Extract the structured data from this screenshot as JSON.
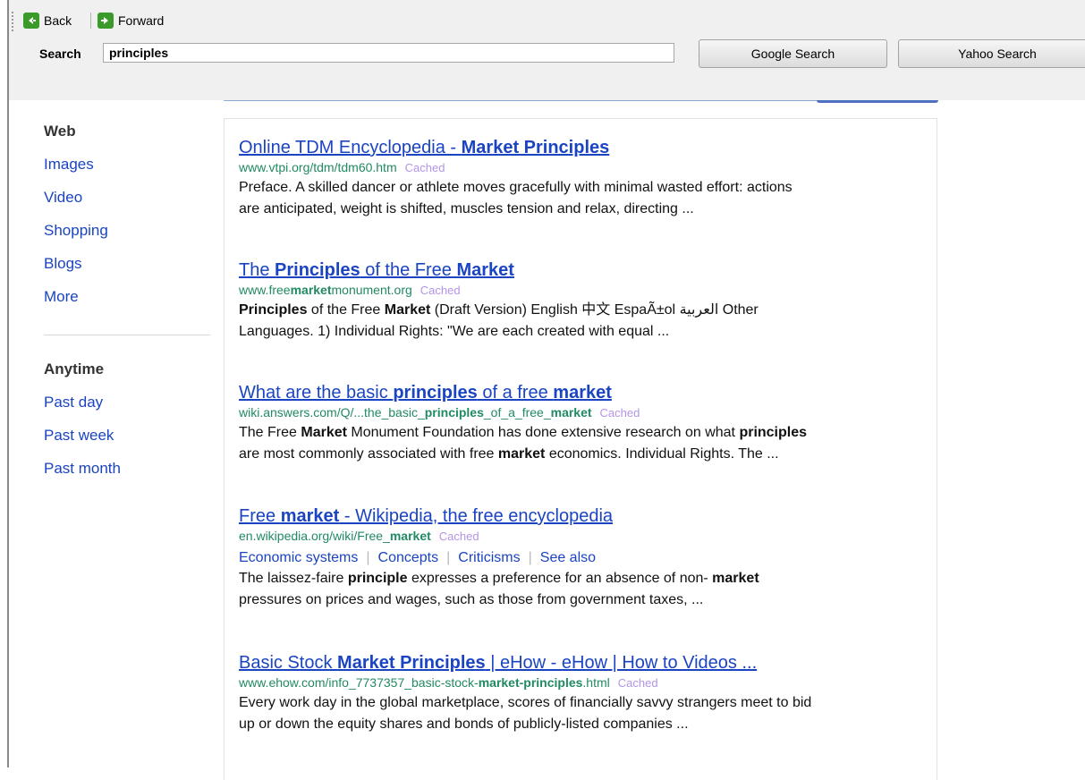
{
  "toolbar": {
    "back_label": "Back",
    "forward_label": "Forward",
    "search_label": "Search",
    "search_value": "principles",
    "google_button": "Google Search",
    "yahoo_button": "Yahoo Search"
  },
  "sidebar": {
    "types": [
      {
        "label": "Web",
        "active": true
      },
      {
        "label": "Images",
        "active": false
      },
      {
        "label": "Video",
        "active": false
      },
      {
        "label": "Shopping",
        "active": false
      },
      {
        "label": "Blogs",
        "active": false
      },
      {
        "label": "More",
        "active": false
      }
    ],
    "times": [
      {
        "label": "Anytime",
        "active": true
      },
      {
        "label": "Past day",
        "active": false
      },
      {
        "label": "Past week",
        "active": false
      },
      {
        "label": "Past month",
        "active": false
      }
    ]
  },
  "cached_label": "Cached",
  "results": [
    {
      "title": [
        [
          "Online TDM Encyclopedia - ",
          false
        ],
        [
          "Market Principles",
          true
        ]
      ],
      "url": [
        [
          "www.vtpi.org/tdm/tdm60.htm",
          false
        ]
      ],
      "links": [],
      "snippet": [
        [
          [
            "Preface. A skilled dancer or athlete moves gracefully with minimal wasted effort: actions",
            false
          ]
        ],
        [
          [
            "are anticipated, weight is shifted, muscles tension and relax, directing ...",
            false
          ]
        ]
      ]
    },
    {
      "title": [
        [
          "The ",
          false
        ],
        [
          "Principles",
          true
        ],
        [
          " of the Free ",
          false
        ],
        [
          "Market",
          true
        ]
      ],
      "url": [
        [
          "www.free",
          false
        ],
        [
          "market",
          true
        ],
        [
          "monument.org",
          false
        ]
      ],
      "links": [],
      "snippet": [
        [
          [
            "Principles",
            true
          ],
          [
            " of the Free ",
            false
          ],
          [
            "Market",
            true
          ],
          [
            " (Draft Version) English 中文 EspaÃ±ol العربية Other",
            false
          ]
        ],
        [
          [
            "Languages. 1) Individual Rights: \"We are each created with equal ...",
            false
          ]
        ]
      ]
    },
    {
      "title": [
        [
          "What are the basic ",
          false
        ],
        [
          "principles",
          true
        ],
        [
          " of a free ",
          false
        ],
        [
          "market",
          true
        ]
      ],
      "url": [
        [
          "wiki.answers.com/Q/...the_basic_",
          false
        ],
        [
          "principles",
          true
        ],
        [
          "_of_a_free_",
          false
        ],
        [
          "market",
          true
        ]
      ],
      "links": [],
      "snippet": [
        [
          [
            "The Free ",
            false
          ],
          [
            "Market",
            true
          ],
          [
            " Monument Foundation has done extensive research on what ",
            false
          ],
          [
            "principles",
            true
          ]
        ],
        [
          [
            "are most commonly associated with free ",
            false
          ],
          [
            "market",
            true
          ],
          [
            " economics. Individual Rights. The ...",
            false
          ]
        ]
      ]
    },
    {
      "title": [
        [
          "Free ",
          false
        ],
        [
          "market",
          true
        ],
        [
          " - Wikipedia, the free encyclopedia",
          false
        ]
      ],
      "url": [
        [
          "en.wikipedia.org/wiki/Free_",
          false
        ],
        [
          "market",
          true
        ]
      ],
      "links": [
        "Economic systems",
        "Concepts",
        "Criticisms",
        "See also"
      ],
      "snippet": [
        [
          [
            "The laissez-faire ",
            false
          ],
          [
            "principle",
            true
          ],
          [
            " expresses a preference for an absence of non- ",
            false
          ],
          [
            "market",
            true
          ]
        ],
        [
          [
            "pressures on prices and wages, such as those from government taxes, ...",
            false
          ]
        ]
      ]
    },
    {
      "title": [
        [
          "Basic Stock ",
          false
        ],
        [
          "Market Principles",
          true
        ],
        [
          " | eHow - eHow | How to Videos ...",
          false
        ]
      ],
      "url": [
        [
          "www.ehow.com/info_7737357_basic-stock-",
          false
        ],
        [
          "market-principles",
          true
        ],
        [
          ".html",
          false
        ]
      ],
      "links": [],
      "snippet": [
        [
          [
            "Every work day in the global marketplace, scores of financially savvy strangers meet to bid",
            false
          ]
        ],
        [
          [
            "up or down the equity shares and bonds of publicly-listed companies ...",
            false
          ]
        ]
      ]
    }
  ]
}
